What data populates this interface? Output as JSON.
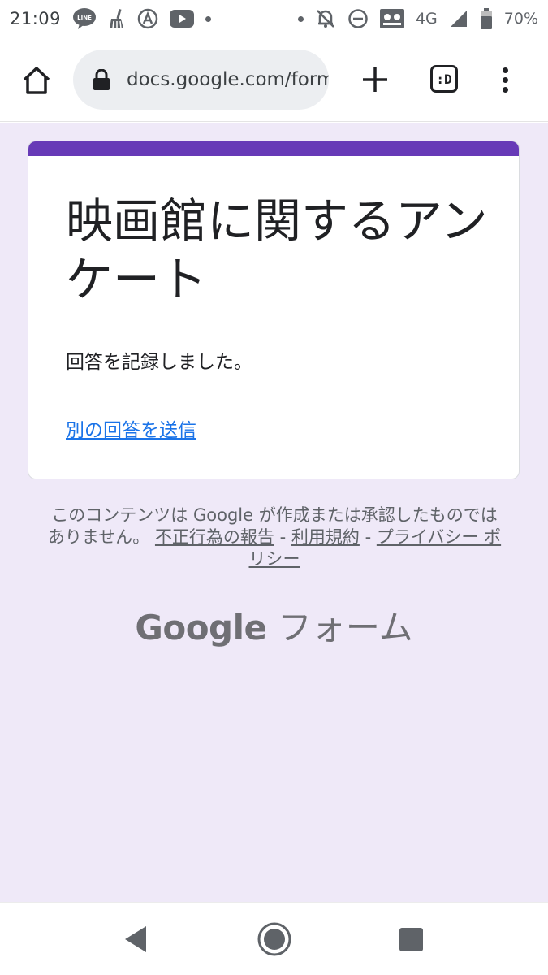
{
  "status_bar": {
    "time": "21:09",
    "network": "4G",
    "battery": "70%",
    "line_icon_text": "LINE",
    "icons": [
      "line-icon",
      "broom-icon",
      "aurora-icon",
      "youtube-icon",
      "dot-icon",
      "dot-icon",
      "mute-icon",
      "dnd-icon",
      "voicemail-icon",
      "signal-icon",
      "battery-icon"
    ]
  },
  "browser": {
    "url": "docs.google.com/forms",
    "tabs_label": ":D",
    "icons": [
      "home-icon",
      "lock-icon",
      "plus-icon",
      "tabs-icon",
      "more-vert-icon"
    ]
  },
  "form": {
    "title": "映画館に関するアンケート",
    "confirmation": "回答を記録しました。",
    "resubmit_link": "別の回答を送信",
    "accent_color": "#673ab7",
    "background_color": "#efe9f8"
  },
  "footer": {
    "disclaimer": "このコンテンツは Google が作成または承認したものではありません。",
    "report_link": "不正行為の報告",
    "separator": "-",
    "terms_link": "利用規約",
    "privacy_link": "プライバシー ポリシー",
    "brand_google": "Google",
    "brand_forms": "フォーム"
  },
  "nav_bar": {
    "icons": [
      "back-icon",
      "home-circle-icon",
      "recents-icon"
    ]
  }
}
